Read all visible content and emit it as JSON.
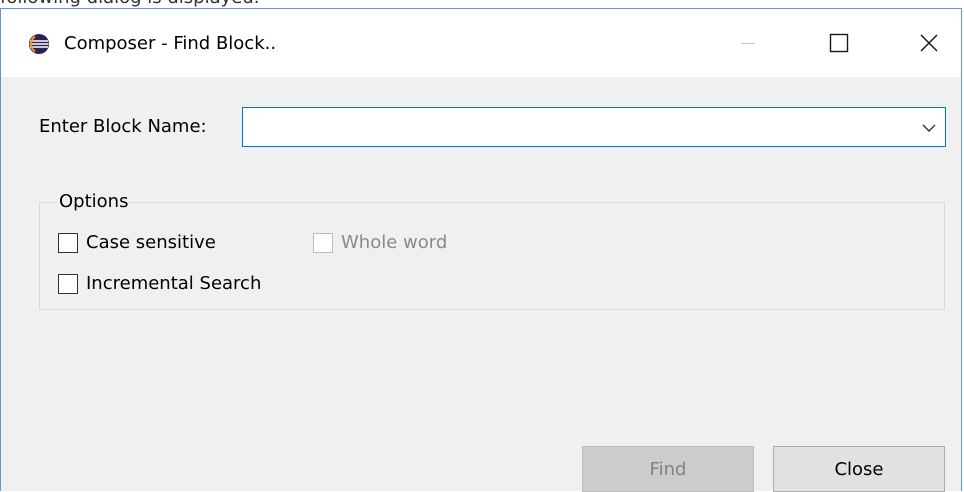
{
  "page": {
    "caption": "following dialog is displayed."
  },
  "dialog": {
    "title": "Composer - Find Block..",
    "app_icon": "eclipse-icon",
    "window_controls": {
      "minimize_icon": "minimize-icon",
      "maximize_icon": "maximize-icon",
      "close_icon": "close-icon"
    }
  },
  "form": {
    "block_name_label": "Enter Block Name:",
    "block_name_value": "",
    "dropdown_icon": "chevron-down-icon"
  },
  "options": {
    "legend": "Options",
    "case_sensitive": {
      "label": "Case sensitive",
      "checked": false,
      "enabled": true
    },
    "whole_word": {
      "label": "Whole word",
      "checked": false,
      "enabled": false
    },
    "incremental_search": {
      "label": "Incremental Search",
      "checked": false,
      "enabled": true
    }
  },
  "buttons": {
    "find_label": "Find",
    "find_enabled": false,
    "close_label": "Close"
  },
  "colors": {
    "focus_border": "#0078d7",
    "dialog_border": "#5b9bd5",
    "dialog_background": "#f0f0f0",
    "disabled_text": "#838383"
  }
}
